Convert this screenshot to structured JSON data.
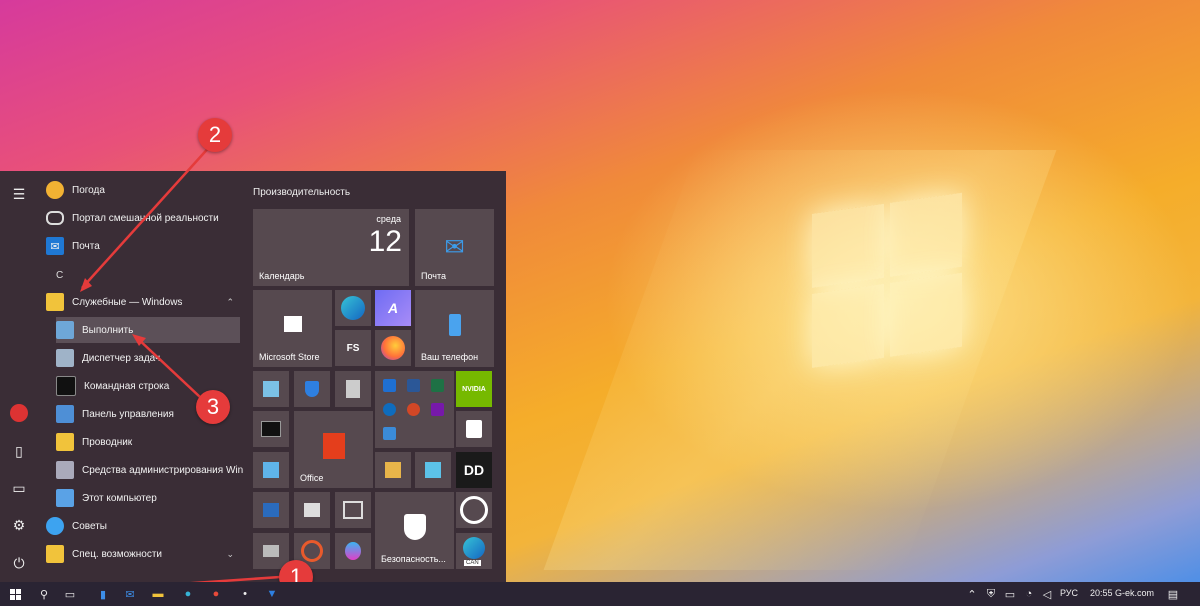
{
  "start_menu": {
    "apps": [
      {
        "label": "Погода"
      },
      {
        "label": "Портал смешанной реальности"
      },
      {
        "label": "Почта"
      },
      {
        "letter": "С"
      },
      {
        "label": "Служебные — Windows"
      },
      {
        "label": "Выполнить"
      },
      {
        "label": "Диспетчер задач"
      },
      {
        "label": "Командная строка"
      },
      {
        "label": "Панель управления"
      },
      {
        "label": "Проводник"
      },
      {
        "label": "Средства администрирования Win..."
      },
      {
        "label": "Этот компьютер"
      },
      {
        "label": "Советы"
      },
      {
        "label": "Спец. возможности"
      }
    ],
    "tiles": {
      "group_title": "Производительность",
      "calendar": {
        "day": "среда",
        "date": "12",
        "label": "Календарь"
      },
      "mail_label": "Почта",
      "store_label": "Microsoft Store",
      "fs_label": "FS",
      "phone_label": "Ваш телефон",
      "office_label": "Office",
      "nvidia_label": "NVIDIA",
      "security_label": "Безопасность...",
      "edge_can_label": "CAN"
    }
  },
  "annotations": {
    "badge1": "1",
    "badge2": "2",
    "badge3": "3"
  },
  "taskbar": {
    "language": "РУС",
    "clock": "20:55 G-ek.com"
  },
  "colors": {
    "accent": "#e53b3b",
    "menu_bg": "#3a2d36",
    "tile_bg": "#56494f"
  }
}
